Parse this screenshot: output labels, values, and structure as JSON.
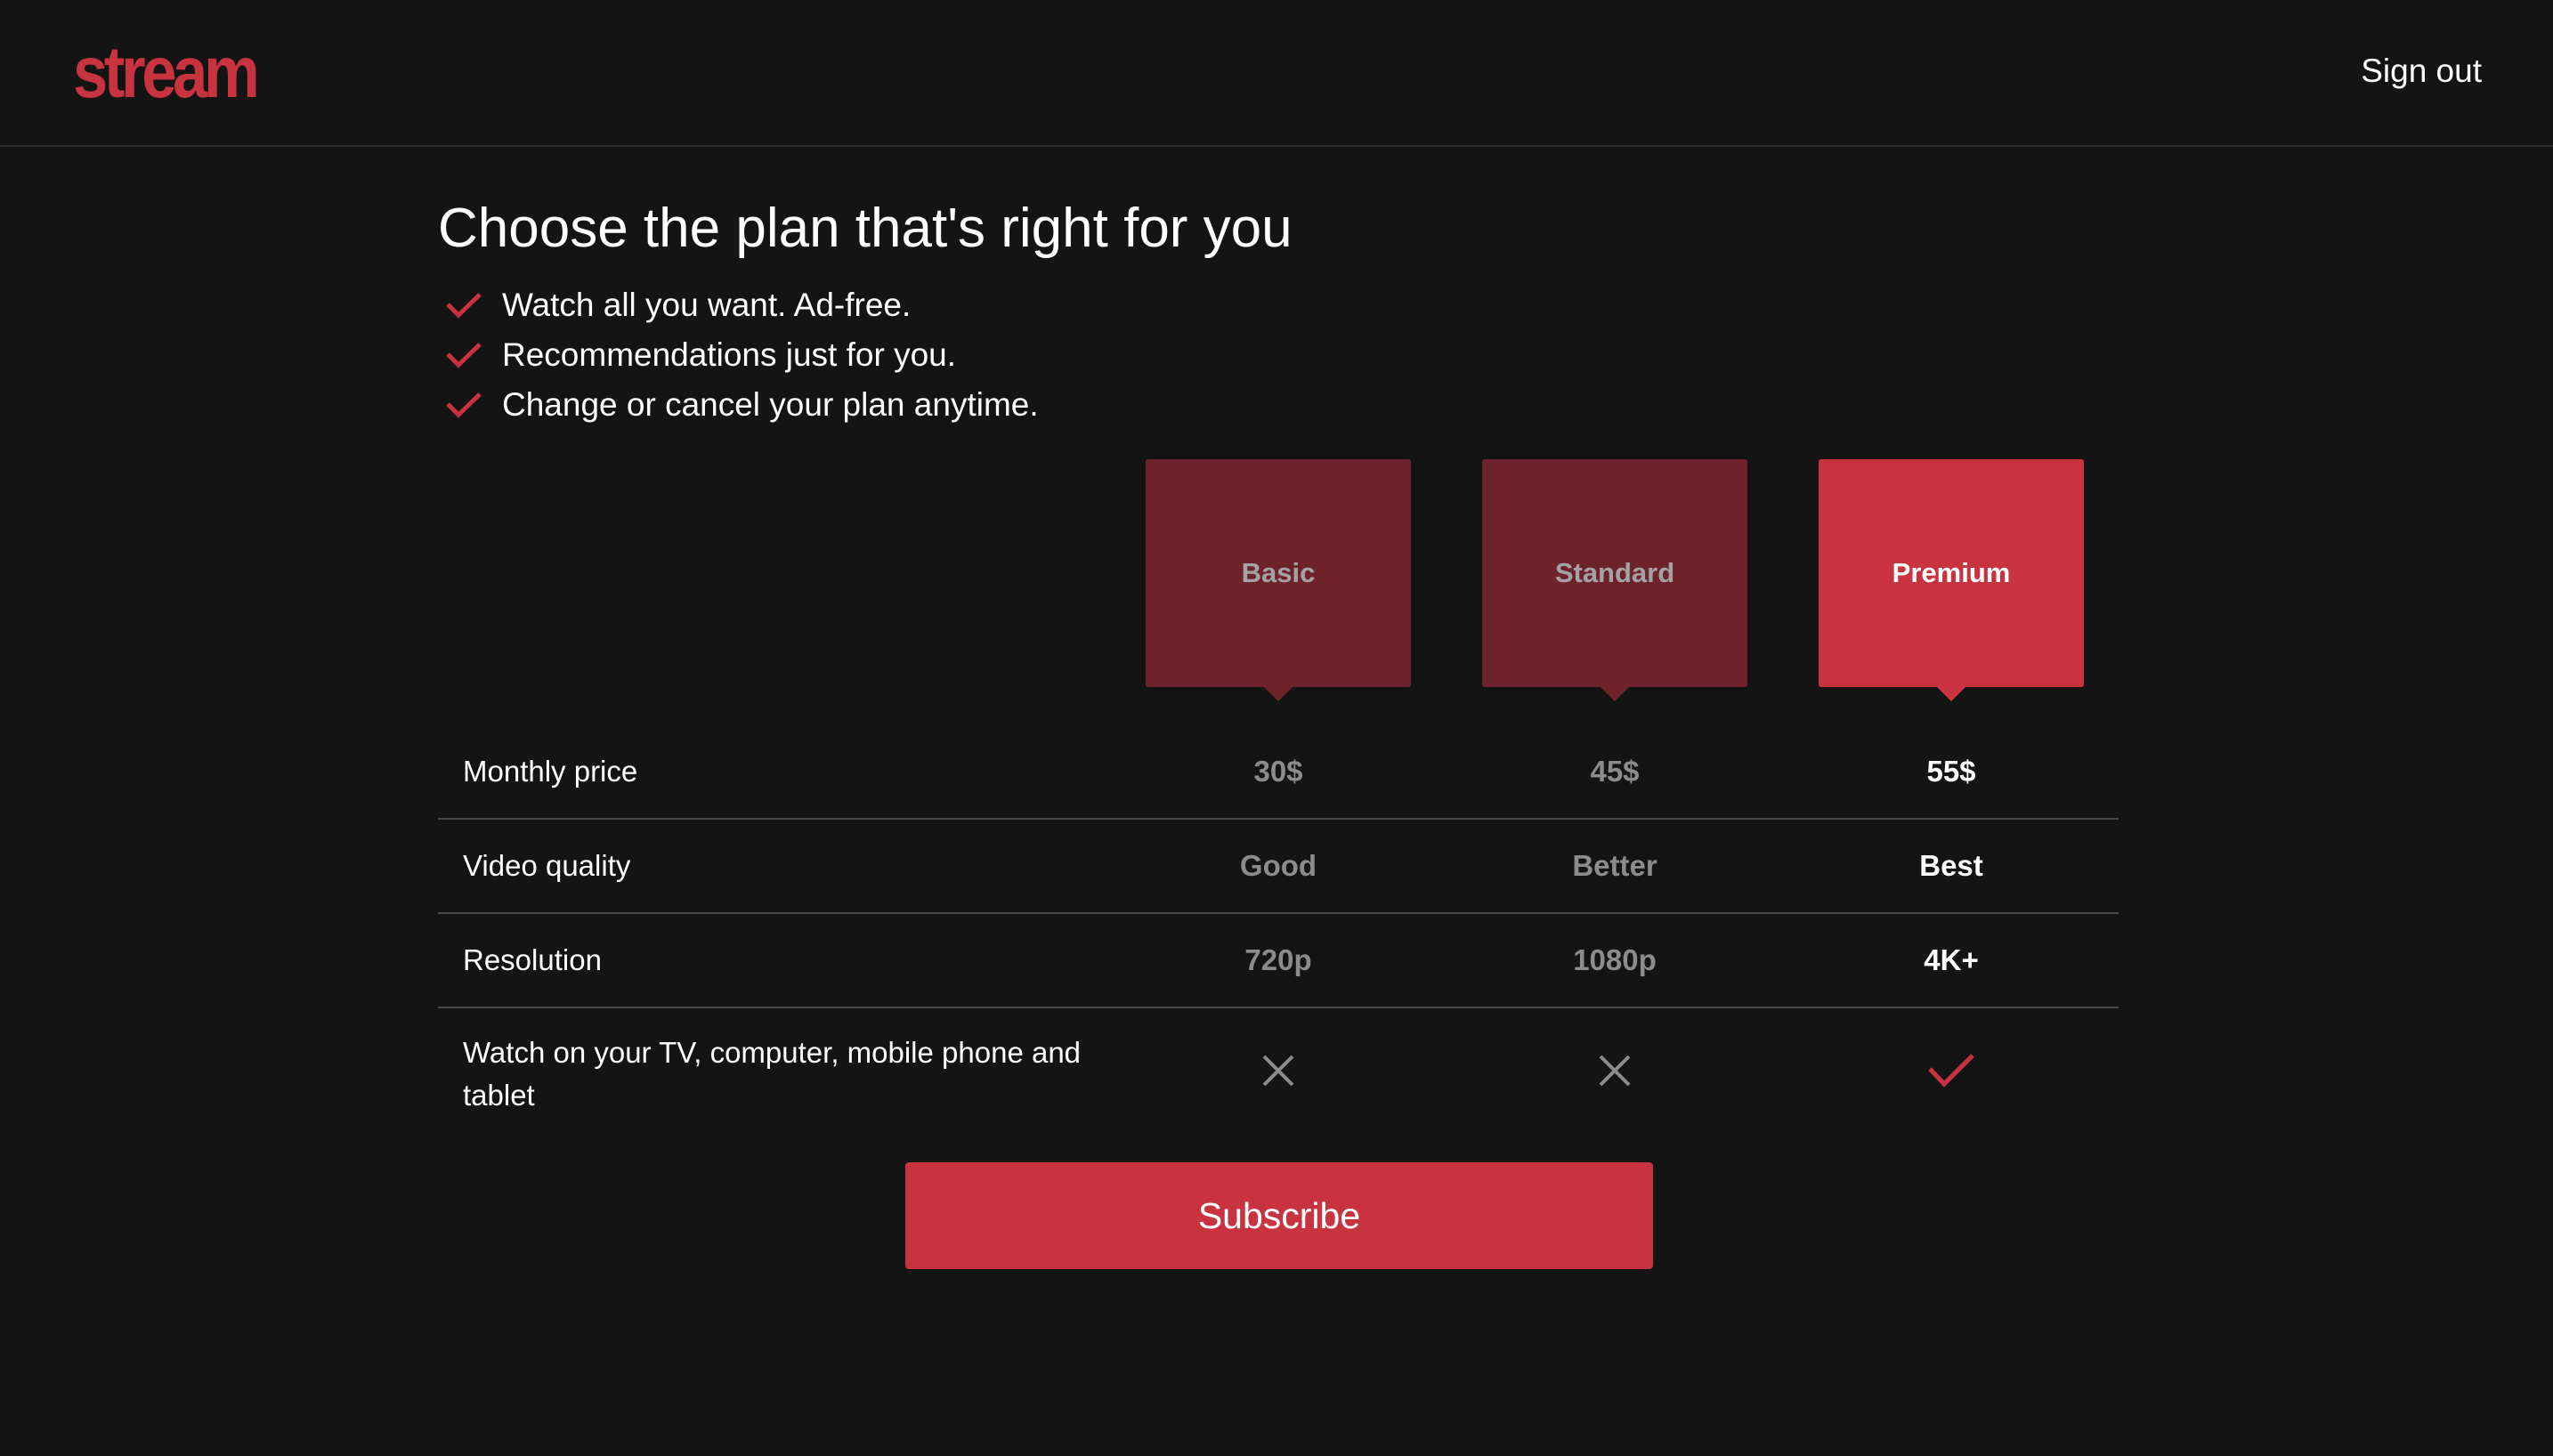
{
  "header": {
    "logo_text": "stream",
    "signout_label": "Sign out"
  },
  "page": {
    "title": "Choose the plan that's right for you",
    "features": [
      "Watch all you want. Ad-free.",
      "Recommendations just for you.",
      "Change or cancel your plan anytime."
    ]
  },
  "plans": [
    {
      "name": "Basic",
      "selected": false
    },
    {
      "name": "Standard",
      "selected": false
    },
    {
      "name": "Premium",
      "selected": true
    }
  ],
  "comparison": {
    "rows": [
      {
        "label": "Monthly price",
        "values": [
          "30$",
          "45$",
          "55$"
        ]
      },
      {
        "label": "Video quality",
        "values": [
          "Good",
          "Better",
          "Best"
        ]
      },
      {
        "label": "Resolution",
        "values": [
          "720p",
          "1080p",
          "4K+"
        ]
      },
      {
        "label": "Watch on your TV, computer, mobile phone and tablet",
        "values": [
          "x-icon",
          "x-icon",
          "check-icon"
        ]
      }
    ]
  },
  "actions": {
    "subscribe_label": "Subscribe"
  },
  "colors": {
    "background": "#141414",
    "accent": "#c93340",
    "accent_dim": "#6e232b",
    "muted_text": "#8c8c8c",
    "divider": "#4a4a4a"
  }
}
